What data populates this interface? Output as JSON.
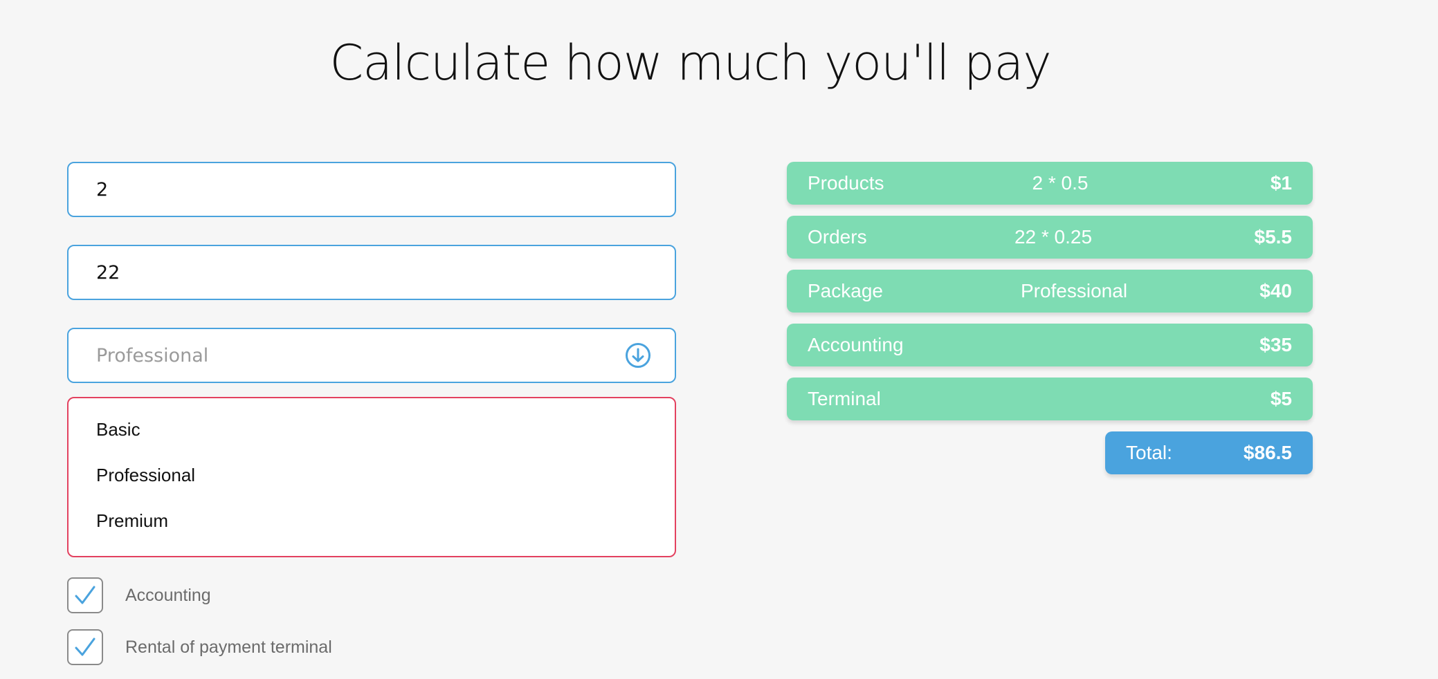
{
  "title": "Calculate how much you'll pay",
  "form": {
    "products_value": "2",
    "orders_value": "22",
    "package_selected": "Professional",
    "package_options": [
      "Basic",
      "Professional",
      "Premium"
    ],
    "checkboxes": [
      {
        "label": "Accounting",
        "checked": true
      },
      {
        "label": "Rental of payment terminal",
        "checked": true
      }
    ]
  },
  "summary": {
    "lines": [
      {
        "name": "Products",
        "formula": "2 * 0.5",
        "amount": "$1"
      },
      {
        "name": "Orders",
        "formula": "22 * 0.25",
        "amount": "$5.5"
      },
      {
        "name": "Package",
        "formula": "Professional",
        "amount": "$40"
      },
      {
        "name": "Accounting",
        "formula": "",
        "amount": "$35"
      },
      {
        "name": "Terminal",
        "formula": "",
        "amount": "$5"
      }
    ],
    "total_label": "Total:",
    "total_amount": "$86.5"
  },
  "colors": {
    "accent_blue": "#4aa3de",
    "dropdown_border": "#e3415f",
    "summary_green": "#7edcb3",
    "background": "#f6f6f6"
  },
  "icons": {
    "select_arrow": "arrow-down-circle-icon",
    "checkbox_check": "checkmark-icon"
  }
}
